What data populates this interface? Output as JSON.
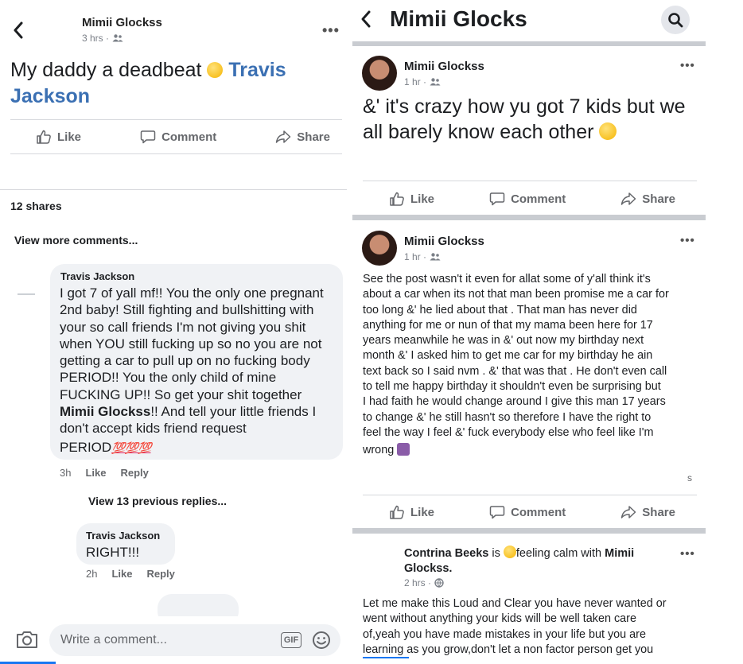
{
  "left": {
    "author": "Mimii Glockss",
    "time": "3 hrs ·",
    "post_text_start": "My daddy a deadbeat ",
    "post_mention": "Travis Jackson",
    "actions": {
      "like": "Like",
      "comment": "Comment",
      "share": "Share"
    },
    "shares": "12 shares",
    "view_more": "View more comments...",
    "comment1": {
      "name": "Travis Jackson",
      "text_lines": [
        "I got 7 of yall mf!! You the only one pregnant",
        "2nd baby! Still fighting and bullshitting with",
        "your so call friends I'm not giving you shit",
        "when YOU still fucking up so no you are not",
        "getting a car to pull up on no fucking body",
        "PERIOD!! You the only child of mine",
        "FUCKING UP!! So get your shit together"
      ],
      "mention": "Mimii Glockss",
      "after_mention": "!! And tell your little friends I",
      "line_after": "don't accept kids friend request",
      "last_line": "PERIOD",
      "emojis": "💯💯💯",
      "time": "3h",
      "like": "Like",
      "reply": "Reply"
    },
    "view_prev": "View 13 previous replies...",
    "comment2": {
      "name": "Travis Jackson",
      "text": "RIGHT!!!",
      "time": "2h",
      "like": "Like",
      "reply": "Reply"
    },
    "comment_placeholder": "Write a comment...",
    "gif_label": "GIF"
  },
  "right": {
    "header_title": "Mimii Glocks",
    "post1": {
      "author": "Mimii Glockss",
      "time": "1 hr ·",
      "text_line1": "&' it's crazy how yu got 7 kids but we",
      "text_line2": "all barely know each other "
    },
    "post2": {
      "author": "Mimii Glockss",
      "time": "1 hr ·",
      "lines": [
        "See the post wasn't it even for allat some of y'all think it's",
        "about a car when its not that man been promise me a car for",
        "too long &' he lied about that . That man has never did",
        "anything for me or nun of that my mama been here for 17",
        "years meanwhile he was in &' out now my birthday next",
        "month &' I asked him to get me car for my birthday he ain",
        "text back so I said nvm . &' that was that . He don't even call",
        "to tell me happy birthday it shouldn't even be surprising but",
        "I had faith he would change around I give this man 17 years",
        "to change &' he still hasn't so therefore I have the right to",
        "feel the way I feel &' fuck everybody else who feel like I'm"
      ],
      "last_line": "wrong ",
      "s_letter": "s"
    },
    "actions": {
      "like": "Like",
      "comment": "Comment",
      "share": "Share"
    },
    "post3": {
      "author": "Contrina Beeks",
      "is": " is ",
      "feeling": "feeling calm with ",
      "with_name_1": "Mimii",
      "with_name_2": "Glockss.",
      "time": "2 hrs ·",
      "lines": [
        "Let me make this Loud and Clear you have never wanted or",
        "went without anything your kids will be well taken care",
        "of,yeah you have made mistakes in your life but you are",
        "learning as you grow,don't let a non factor person get you"
      ]
    }
  }
}
